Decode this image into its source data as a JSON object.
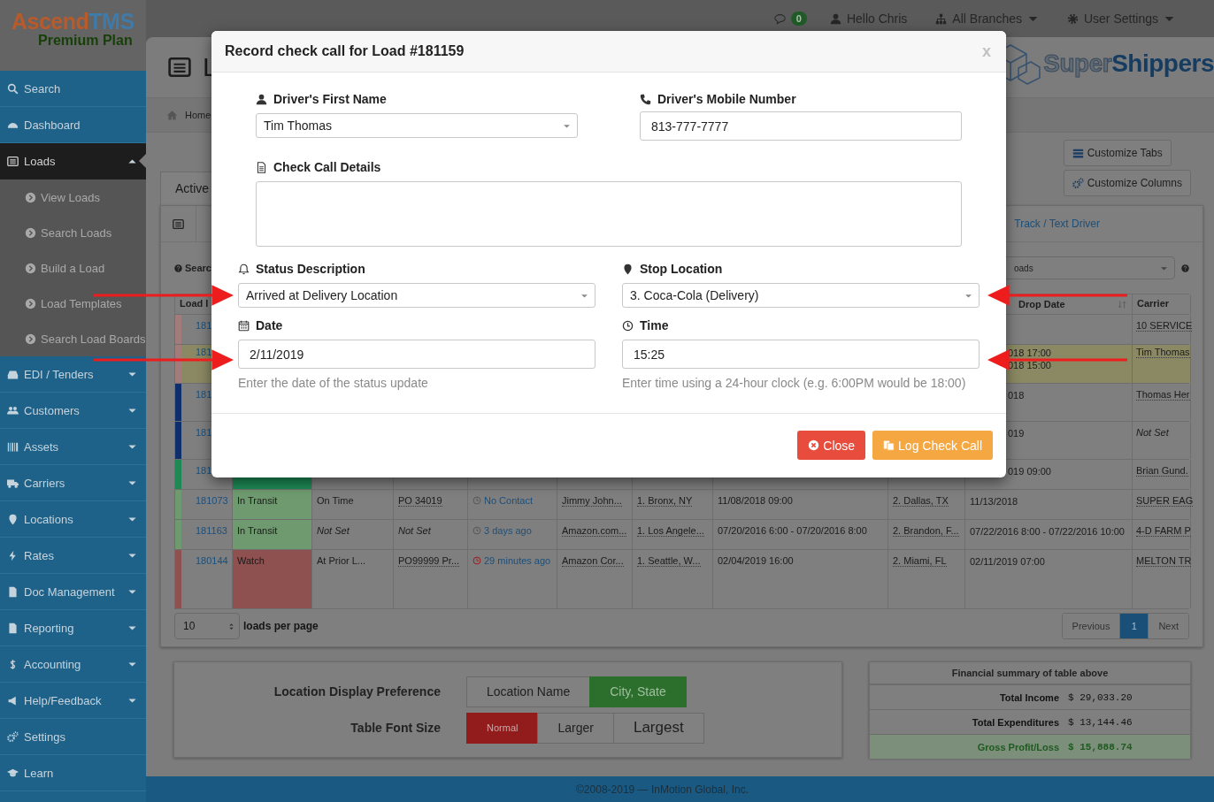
{
  "app": {
    "name_primary": "Ascend",
    "name_secondary": "TMS",
    "plan": "Premium Plan"
  },
  "top_bar": {
    "message_count": "0",
    "greeting": "Hello Chris",
    "branches": "All Branches",
    "settings": "User Settings"
  },
  "sidebar": {
    "items": [
      {
        "label": "Search",
        "selected": false
      },
      {
        "label": "Dashboard",
        "selected": false
      },
      {
        "label": "Loads",
        "selected": true,
        "expanded": true,
        "children": [
          {
            "label": "View Loads",
            "selected": false
          },
          {
            "label": "Search Loads",
            "selected": false
          },
          {
            "label": "Build a Load",
            "selected": false
          },
          {
            "label": "Load Templates",
            "selected": false
          },
          {
            "label": "Search Load Boards",
            "selected": false
          }
        ]
      },
      {
        "label": "EDI / Tenders",
        "selected": false,
        "expanded": false
      },
      {
        "label": "Customers",
        "selected": false,
        "expanded": false
      },
      {
        "label": "Assets",
        "selected": false,
        "expanded": false
      },
      {
        "label": "Carriers",
        "selected": false,
        "expanded": false
      },
      {
        "label": "Locations",
        "selected": false,
        "expanded": false
      },
      {
        "label": "Rates",
        "selected": false,
        "expanded": false
      },
      {
        "label": "Doc Management",
        "selected": false,
        "expanded": false
      },
      {
        "label": "Reporting",
        "selected": false,
        "expanded": false
      },
      {
        "label": "Accounting",
        "selected": false,
        "expanded": false
      },
      {
        "label": "Help/Feedback",
        "selected": false,
        "expanded": false
      },
      {
        "label": "Settings",
        "selected": false
      },
      {
        "label": "Learn",
        "selected": false
      }
    ]
  },
  "page": {
    "title": "L",
    "breadcrumb": "Home",
    "brand_first": "Super",
    "brand_second": "Shippers"
  },
  "tabs": [
    {
      "label": "Active",
      "selected": true
    }
  ],
  "view_buttons": [
    "Customize Tabs",
    "Customize Columns"
  ],
  "table_panel": {
    "track_link": "Track / Text Driver",
    "search_label": "Searc",
    "filter_value": "oads"
  },
  "table": {
    "header": {
      "load_id": "Load I",
      "drop_date": "Drop Date",
      "carrier": "Carrier"
    },
    "rows": [
      {
        "color": "#a27b7b",
        "highlight": false,
        "load_id": "181",
        "carrier": {
          "text": "10 SERVICE",
          "kind": "dotted"
        }
      },
      {
        "color": "#a27b7b",
        "highlight": true,
        "load_id": "181",
        "drop_date": [
          "018 17:00",
          "018 15:00"
        ],
        "carrier": {
          "text": "Tim Thomas",
          "kind": "dotted"
        }
      },
      {
        "color": "#0e2f6b",
        "highlight": false,
        "load_id": "181",
        "drop_date": [
          "018"
        ],
        "carrier": {
          "text": "Thomas Her",
          "kind": "dotted"
        }
      },
      {
        "color": "#0e2f6b",
        "highlight": false,
        "load_id": "181",
        "drop_date": [
          "019"
        ],
        "carrier": {
          "text": "Not Set",
          "kind": "unset"
        }
      },
      {
        "color": "#1d8a55",
        "highlight": false,
        "load_id": "181",
        "drop_date": [
          "019 09:00"
        ],
        "carrier": {
          "text": "Brian Gund.",
          "kind": "dotted"
        }
      },
      {
        "color": "#6f9a6f",
        "highlight": false,
        "load_id": "181073",
        "status": "In Transit",
        "details": [
          {
            "text": "On Time",
            "kind": "plain"
          },
          {
            "text": "PO 34019",
            "kind": "dotted"
          },
          {
            "text": "No Contact",
            "kind": "contact"
          },
          {
            "text": "Jimmy John...",
            "kind": "dotted"
          },
          {
            "text": "1. Bronx, NY",
            "kind": "dotted"
          },
          {
            "text": "11/08/2018 09:00",
            "kind": "plain"
          },
          {
            "text": "2. Dallas, TX",
            "kind": "dotted"
          }
        ],
        "drop_date": [
          "11/13/2018"
        ],
        "carrier": {
          "text": "SUPER EAG",
          "kind": "dotted"
        }
      },
      {
        "color": "#6f9a6f",
        "highlight": false,
        "load_id": "181163",
        "status": "In Transit",
        "details": [
          {
            "text": "Not Set",
            "kind": "unset"
          },
          {
            "text": "Not Set",
            "kind": "unset"
          },
          {
            "text": "3 days ago",
            "kind": "contact"
          },
          {
            "text": "Amazon.com...",
            "kind": "dotted"
          },
          {
            "text": "1. Los Angele...",
            "kind": "dotted"
          },
          {
            "text": "07/20/2016 6:00 - 07/20/2016 8:00",
            "kind": "plain"
          },
          {
            "text": "2. Brandon, F...",
            "kind": "dotted"
          }
        ],
        "drop_date": [
          "07/22/2016 8:00 - 07/22/2016 10:00"
        ],
        "carrier": {
          "text": "4-D FARM P",
          "kind": "dotted"
        }
      },
      {
        "color": "#8f5050",
        "highlight": false,
        "load_id": "180144",
        "status": "Watch",
        "details": [
          {
            "text": "At Prior L...",
            "kind": "plain"
          },
          {
            "text": "PO99999 Pr...",
            "kind": "dotted"
          },
          {
            "text": "29 minutes ago",
            "kind": "contact-late"
          },
          {
            "text": "Amazon Cor...",
            "kind": "dotted"
          },
          {
            "text": "1. Seattle, W...",
            "kind": "dotted"
          },
          {
            "text": "02/04/2019 16:00",
            "kind": "plain"
          },
          {
            "text": "2. Miami, FL",
            "kind": "dotted"
          }
        ],
        "drop_date": [
          "02/11/2019 07:00"
        ],
        "carrier": {
          "text": "MELTON TR",
          "kind": "dotted"
        }
      }
    ]
  },
  "pagination": {
    "page_size": "10",
    "page_size_label": "loads per page",
    "previous": "Previous",
    "pages": [
      {
        "label": "1",
        "selected": true
      }
    ],
    "next": "Next"
  },
  "preferences": [
    {
      "label": "Location Display Preference",
      "kind": "location",
      "options": [
        {
          "label": "Location Name",
          "selected": false
        },
        {
          "label": "City, State",
          "selected": true
        }
      ]
    },
    {
      "label": "Table Font Size",
      "kind": "font-size",
      "options": [
        {
          "label": "Normal",
          "selected": true
        },
        {
          "label": "Larger",
          "selected": false
        },
        {
          "label": "Largest",
          "selected": false
        }
      ]
    }
  ],
  "summary": {
    "title": "Financial summary of table above",
    "rows": [
      {
        "label": "Total Income",
        "value": "$ 29,033.20",
        "kind": "plain"
      },
      {
        "label": "Total Expenditures",
        "value": "$ 13,144.46",
        "kind": "plain"
      },
      {
        "label": "Gross Profit/Loss",
        "value": "$ 15,888.74",
        "kind": "total"
      }
    ]
  },
  "footer": "©2008-2019 — InMotion Global, Inc.",
  "modal": {
    "title": "Record check call for Load #181159",
    "close": "x",
    "upper_fields": [
      {
        "label": "Driver's First Name",
        "kind": "select",
        "value": "Tim Thomas"
      },
      {
        "label": "Driver's Mobile Number",
        "kind": "text",
        "value": "813-777-7777"
      },
      {
        "label": "Check Call Details",
        "kind": "textarea"
      }
    ],
    "lower_fields": [
      {
        "label": "Status Description",
        "kind": "select",
        "value": "Arrived at Delivery Location",
        "arrow": true
      },
      {
        "label": "Stop Location",
        "kind": "select",
        "value": "3. Coca-Cola (Delivery)",
        "arrow": true
      },
      {
        "label": "Date",
        "kind": "text",
        "value": "2/11/2019",
        "help": "Enter the date of the status update",
        "arrow": true
      },
      {
        "label": "Time",
        "kind": "text",
        "value": "15:25",
        "help": "Enter time using a 24-hour clock (e.g. 6:00PM would be 18:00)",
        "arrow": true
      }
    ],
    "buttons": [
      {
        "label": "Close",
        "kind": "danger"
      },
      {
        "label": "Log Check Call",
        "kind": "warning"
      }
    ]
  }
}
